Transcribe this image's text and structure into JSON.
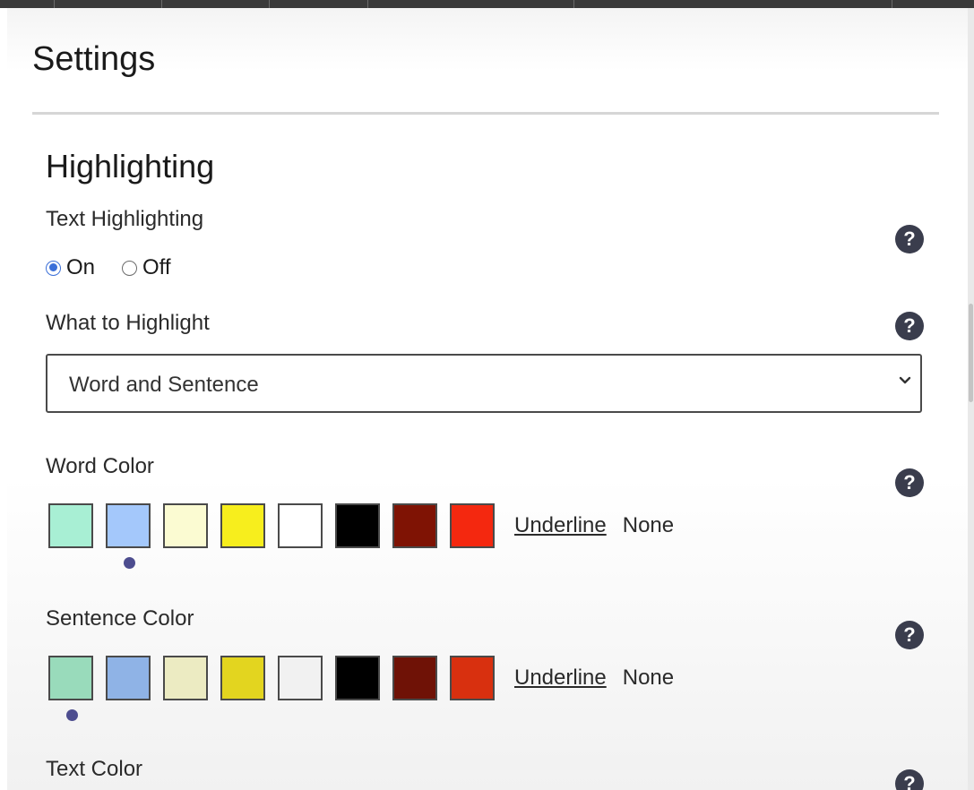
{
  "page": {
    "title": "Settings"
  },
  "highlighting": {
    "section_title": "Highlighting",
    "text_highlighting": {
      "label": "Text Highlighting",
      "options": [
        "On",
        "Off"
      ],
      "selected": "On"
    },
    "what_to_highlight": {
      "label": "What to Highlight",
      "value": "Word and Sentence"
    },
    "word_color": {
      "label": "Word Color",
      "colors": [
        "#a8efd4",
        "#a4c8fb",
        "#fbfbd2",
        "#f7ee1d",
        "#ffffff",
        "#000000",
        "#7f1304",
        "#f4280f"
      ],
      "selected_index": 1,
      "underline_label": "Underline",
      "none_label": "None"
    },
    "sentence_color": {
      "label": "Sentence Color",
      "colors": [
        "#99dbbb",
        "#8fb3e6",
        "#ecebc2",
        "#e3d51f",
        "#f1f1f1",
        "#000000",
        "#6f1206",
        "#d8300f"
      ],
      "selected_index": 0,
      "underline_label": "Underline",
      "none_label": "None"
    },
    "text_color": {
      "label": "Text Color"
    }
  },
  "icons": {
    "help": "question-circle-icon",
    "dropdown": "chevron-down-icon"
  },
  "help_glyph": "?",
  "chevron_glyph": "⌄"
}
